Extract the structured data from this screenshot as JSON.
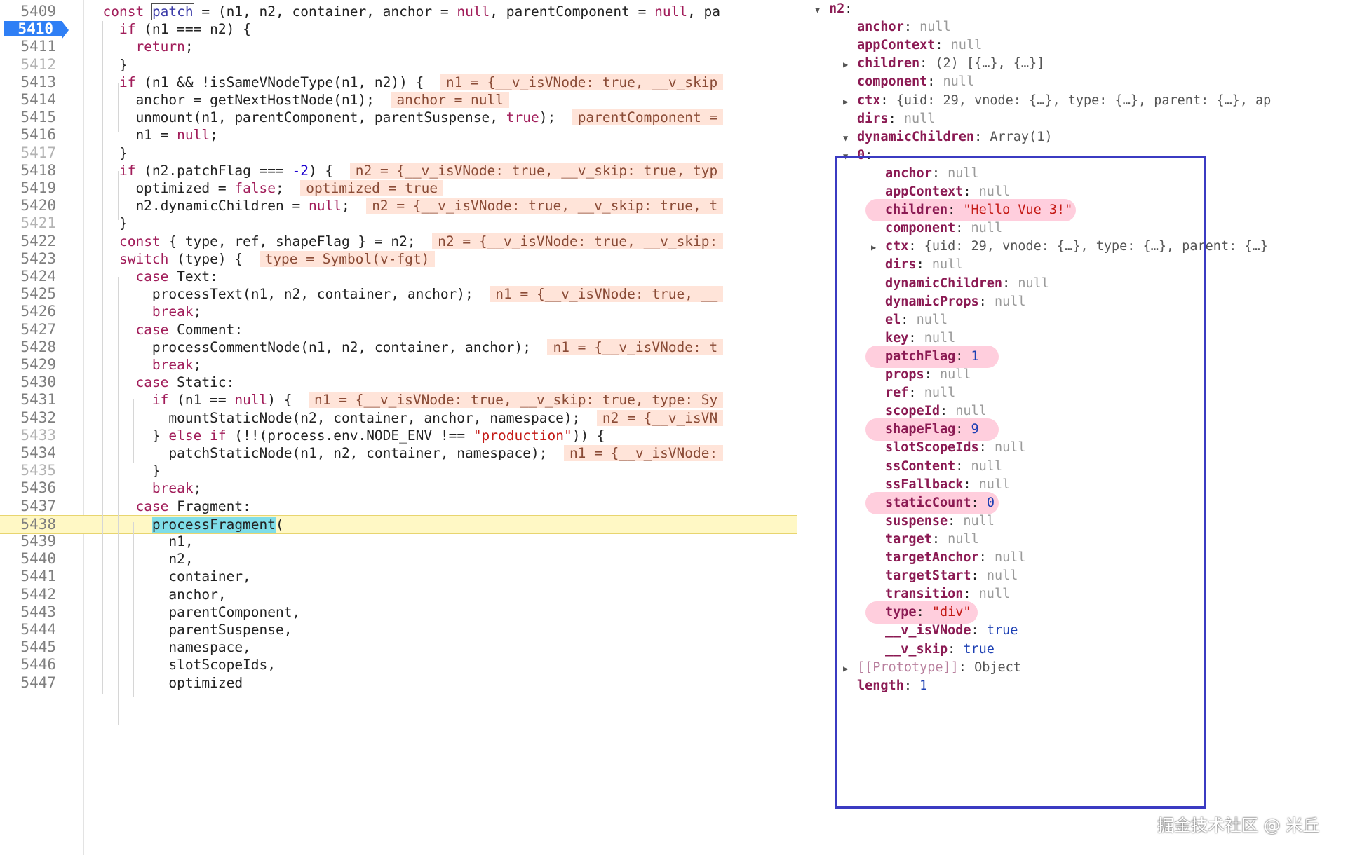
{
  "code": {
    "lines": [
      {
        "n": "5409",
        "t": "  const patch = (n1, n2, container, anchor = null, parentComponent = null, pa"
      },
      {
        "n": "5410",
        "t": "    if (n1 === n2) {"
      },
      {
        "n": "5411",
        "t": "      return;"
      },
      {
        "n": "5412",
        "t": "    }"
      },
      {
        "n": "5413",
        "t": "    if (n1 && !isSameVNodeType(n1, n2)) {",
        "i": "n1 = {__v_isVNode: true, __v_skip"
      },
      {
        "n": "5414",
        "t": "      anchor = getNextHostNode(n1);",
        "i": "anchor = null"
      },
      {
        "n": "5415",
        "t": "      unmount(n1, parentComponent, parentSuspense, true);",
        "i": "parentComponent ="
      },
      {
        "n": "5416",
        "t": "      n1 = null;"
      },
      {
        "n": "5417",
        "t": "    }"
      },
      {
        "n": "5418",
        "t": "    if (n2.patchFlag === -2) {",
        "i": "n2 = {__v_isVNode: true, __v_skip: true, typ"
      },
      {
        "n": "5419",
        "t": "      optimized = false;",
        "i": "optimized = true"
      },
      {
        "n": "5420",
        "t": "      n2.dynamicChildren = null;",
        "i": "n2 = {__v_isVNode: true, __v_skip: true, t"
      },
      {
        "n": "5421",
        "t": "    }"
      },
      {
        "n": "5422",
        "t": "    const { type, ref, shapeFlag } = n2;",
        "i": "n2 = {__v_isVNode: true, __v_skip:"
      },
      {
        "n": "5423",
        "t": "    switch (type) {",
        "i": "type = Symbol(v-fgt)"
      },
      {
        "n": "5424",
        "t": "      case Text:"
      },
      {
        "n": "5425",
        "t": "        processText(n1, n2, container, anchor);",
        "i": "n1 = {__v_isVNode: true, __"
      },
      {
        "n": "5426",
        "t": "        break;"
      },
      {
        "n": "5427",
        "t": "      case Comment:"
      },
      {
        "n": "5428",
        "t": "        processCommentNode(n1, n2, container, anchor);",
        "i": "n1 = {__v_isVNode: t"
      },
      {
        "n": "5429",
        "t": "        break;"
      },
      {
        "n": "5430",
        "t": "      case Static:"
      },
      {
        "n": "5431",
        "t": "        if (n1 == null) {",
        "i": "n1 = {__v_isVNode: true, __v_skip: true, type: Sy"
      },
      {
        "n": "5432",
        "t": "          mountStaticNode(n2, container, anchor, namespace);",
        "i": "n2 = {__v_isVN"
      },
      {
        "n": "5433",
        "t": "        } else if (!!(process.env.NODE_ENV !== \"production\")) {"
      },
      {
        "n": "5434",
        "t": "          patchStaticNode(n1, n2, container, namespace);",
        "i": "n1 = {__v_isVNode:"
      },
      {
        "n": "5435",
        "t": "        }"
      },
      {
        "n": "5436",
        "t": "        break;"
      },
      {
        "n": "5437",
        "t": "      case Fragment:"
      },
      {
        "n": "5438",
        "t": "        processFragment("
      },
      {
        "n": "5439",
        "t": "          n1,"
      },
      {
        "n": "5440",
        "t": "          n2,"
      },
      {
        "n": "5441",
        "t": "          container,"
      },
      {
        "n": "5442",
        "t": "          anchor,"
      },
      {
        "n": "5443",
        "t": "          parentComponent,"
      },
      {
        "n": "5444",
        "t": "          parentSuspense,"
      },
      {
        "n": "5445",
        "t": "          namespace,"
      },
      {
        "n": "5446",
        "t": "          slotScopeIds,"
      },
      {
        "n": "5447",
        "t": "          optimized"
      }
    ]
  },
  "scope": {
    "rows": [
      {
        "k": "n2",
        "v": "",
        "tri": "open",
        "lvl": 0
      },
      {
        "k": "anchor",
        "v": "null",
        "lvl": 1
      },
      {
        "k": "appContext",
        "v": "null",
        "lvl": 1
      },
      {
        "k": "children",
        "v": "(2) [{…}, {…}]",
        "tri": "closed",
        "lvl": 1
      },
      {
        "k": "component",
        "v": "null",
        "lvl": 1
      },
      {
        "k": "ctx",
        "v": "{uid: 29, vnode: {…}, type: {…}, parent: {…}, ap",
        "tri": "closed",
        "lvl": 1
      },
      {
        "k": "dirs",
        "v": "null",
        "lvl": 1
      },
      {
        "k": "dynamicChildren",
        "v": "Array(1)",
        "tri": "open",
        "lvl": 1
      },
      {
        "k": "0",
        "v": "",
        "tri": "open",
        "lvl": 2
      },
      {
        "k": "anchor",
        "v": "null",
        "lvl": 3
      },
      {
        "k": "appContext",
        "v": "null",
        "lvl": 3
      },
      {
        "k": "children",
        "v": "\"Hello Vue 3!\"",
        "lvl": 3
      },
      {
        "k": "component",
        "v": "null",
        "lvl": 3
      },
      {
        "k": "ctx",
        "v": "{uid: 29, vnode: {…}, type: {…}, parent: {…}",
        "tri": "closed",
        "lvl": 3
      },
      {
        "k": "dirs",
        "v": "null",
        "lvl": 3
      },
      {
        "k": "dynamicChildren",
        "v": "null",
        "lvl": 3
      },
      {
        "k": "dynamicProps",
        "v": "null",
        "lvl": 3
      },
      {
        "k": "el",
        "v": "null",
        "lvl": 3
      },
      {
        "k": "key",
        "v": "null",
        "lvl": 3
      },
      {
        "k": "patchFlag",
        "v": "1",
        "lvl": 3
      },
      {
        "k": "props",
        "v": "null",
        "lvl": 3
      },
      {
        "k": "ref",
        "v": "null",
        "lvl": 3
      },
      {
        "k": "scopeId",
        "v": "null",
        "lvl": 3
      },
      {
        "k": "shapeFlag",
        "v": "9",
        "lvl": 3
      },
      {
        "k": "slotScopeIds",
        "v": "null",
        "lvl": 3
      },
      {
        "k": "ssContent",
        "v": "null",
        "lvl": 3
      },
      {
        "k": "ssFallback",
        "v": "null",
        "lvl": 3
      },
      {
        "k": "staticCount",
        "v": "0",
        "lvl": 3
      },
      {
        "k": "suspense",
        "v": "null",
        "lvl": 3
      },
      {
        "k": "target",
        "v": "null",
        "lvl": 3
      },
      {
        "k": "targetAnchor",
        "v": "null",
        "lvl": 3
      },
      {
        "k": "targetStart",
        "v": "null",
        "lvl": 3
      },
      {
        "k": "transition",
        "v": "null",
        "lvl": 3
      },
      {
        "k": "type",
        "v": "\"div\"",
        "lvl": 3
      },
      {
        "k": "__v_isVNode",
        "v": "true",
        "lvl": 3
      },
      {
        "k": "__v_skip",
        "v": "true",
        "lvl": 3
      },
      {
        "k": "[[Prototype]]",
        "v": "Object",
        "tri": "closed",
        "lvl": 2
      },
      {
        "k": "length",
        "v": "1",
        "lvl": 2
      }
    ]
  },
  "watermark": "掘金技术社区 @ 米丘",
  "colors": {
    "breakpoint": "#2f7ff5",
    "frame": "#3b3bc2",
    "current_line": "#fff8c5"
  }
}
